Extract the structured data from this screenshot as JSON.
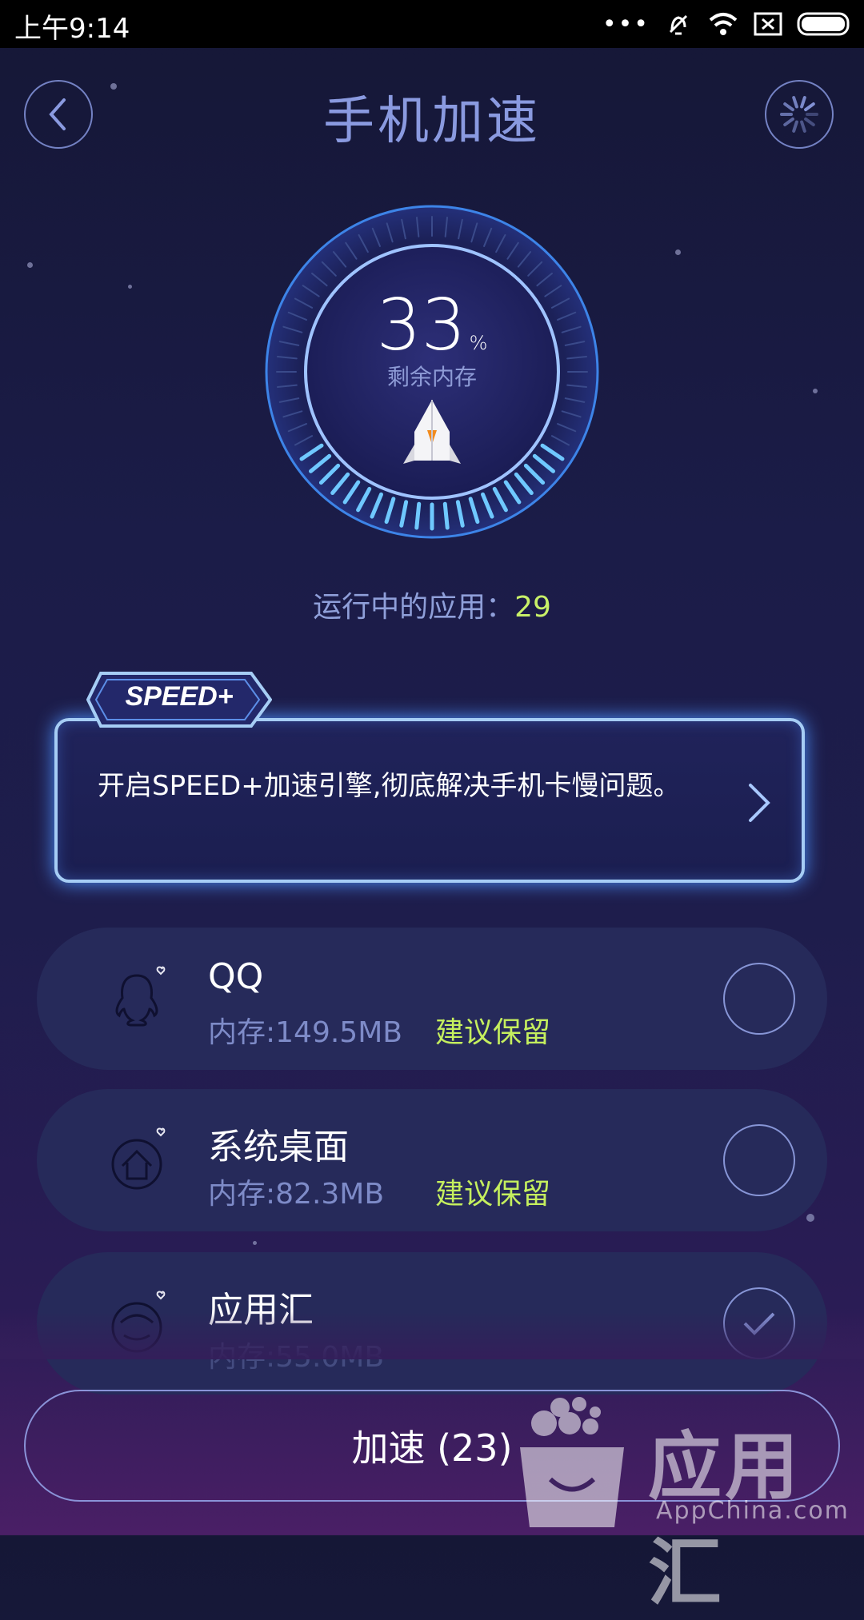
{
  "status_bar": {
    "time": "上午9:14",
    "battery_level": 1.0
  },
  "header": {
    "title": "手机加速"
  },
  "gauge": {
    "percent": "33",
    "unit": "%",
    "label": "剩余内存"
  },
  "running": {
    "label": "运行中的应用：",
    "count": "29"
  },
  "speed_card": {
    "badge": "SPEED+",
    "text": "开启SPEED+加速引擎,彻底解决手机卡慢问题。"
  },
  "apps": [
    {
      "name": "QQ",
      "memory": "内存:149.5MB",
      "tag": "建议保留",
      "checked": false,
      "icon": "qq-penguin-icon"
    },
    {
      "name": "系统桌面",
      "memory": "内存:82.3MB",
      "tag": "建议保留",
      "checked": false,
      "icon": "home-icon"
    },
    {
      "name": "应用汇",
      "memory": "内存:55.0MB",
      "tag": "",
      "checked": true,
      "icon": "appchina-icon"
    }
  ],
  "action": {
    "label": "加速 (23)"
  },
  "watermark": {
    "name": "应用汇",
    "site": "AppChina.com"
  },
  "colors": {
    "accent_green": "#c5ef5e",
    "title_blue": "#8a9ae0",
    "glow_blue": "#4d92ff"
  }
}
